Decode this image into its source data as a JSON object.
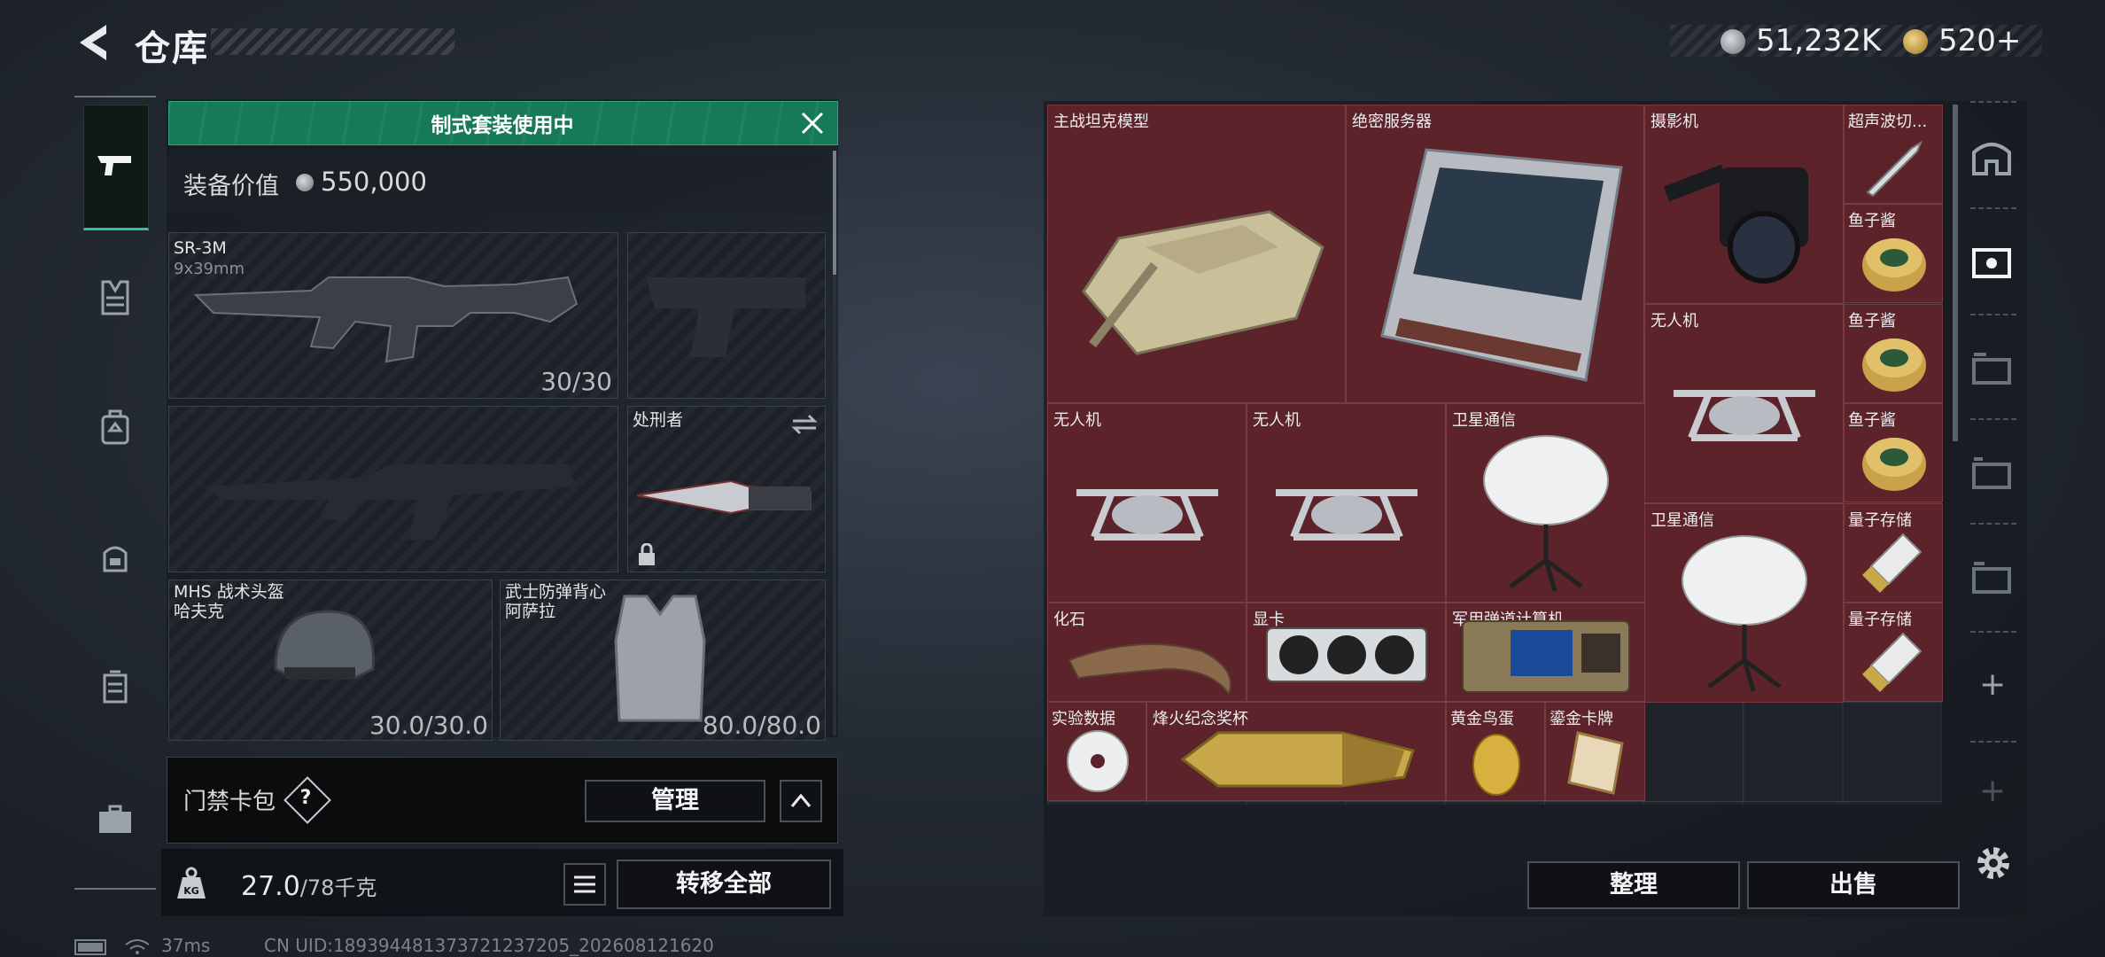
{
  "header": {
    "title": "仓库",
    "currency1": "51,232K",
    "currency2": "520",
    "currency2_add": "+"
  },
  "loadout": {
    "banner": "制式套装使用中",
    "value_label": "装备价值",
    "value": "550,000",
    "primary": {
      "name": "SR-3M",
      "caliber": "9x39mm",
      "ammo": "30/30"
    },
    "melee": {
      "name": "处刑者"
    },
    "helmet": {
      "name": "MHS 战术头盔",
      "sub": "哈夫克",
      "durability": "30.0/30.0"
    },
    "armor": {
      "name": "武士防弹背心",
      "sub": "阿萨拉",
      "durability": "80.0/80.0"
    }
  },
  "card_pack": {
    "label": "门禁卡包",
    "help": "?",
    "manage": "管理"
  },
  "weight": {
    "current": "27.0",
    "max": "/78千克"
  },
  "transfer_all": "转移全部",
  "status": {
    "ping": "37ms",
    "uid": "CN UID:18939448137372123720​5_202608121620"
  },
  "stash": {
    "items": [
      {
        "name": "主战坦克模型"
      },
      {
        "name": "绝密服务器"
      },
      {
        "name": "摄影机"
      },
      {
        "name": "超声波切..."
      },
      {
        "name": "鱼子酱"
      },
      {
        "name": "无人机"
      },
      {
        "name": "鱼子酱"
      },
      {
        "name": "无人机"
      },
      {
        "name": "无人机"
      },
      {
        "name": "卫星通信"
      },
      {
        "name": "鱼子酱"
      },
      {
        "name": "卫星通信"
      },
      {
        "name": "量子存储"
      },
      {
        "name": "化石"
      },
      {
        "name": "显卡"
      },
      {
        "name": "军用弹道计算机"
      },
      {
        "name": "量子存储"
      },
      {
        "name": "实验数据"
      },
      {
        "name": "烽火纪念奖杯"
      },
      {
        "name": "黄金鸟蛋"
      },
      {
        "name": "鎏金卡牌"
      }
    ],
    "sort_button": "整理",
    "sell_button": "出售"
  },
  "right_nav": {
    "plus": "+",
    "plus2": "+"
  },
  "colors": {
    "accent_green": "#167a56",
    "item_bg": "#5c232a"
  }
}
